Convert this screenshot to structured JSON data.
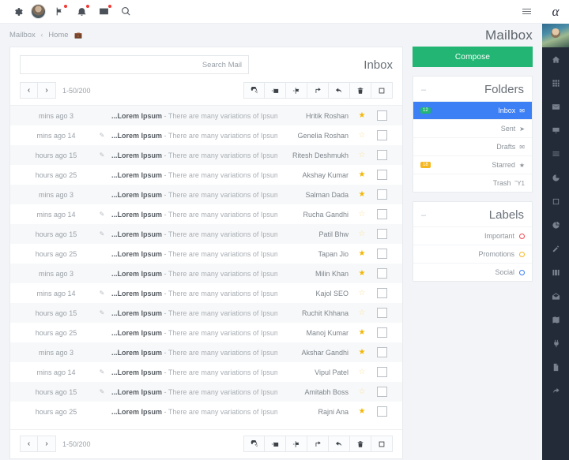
{
  "topbar": {
    "icons": [
      {
        "name": "gear-icon",
        "label": "Settings",
        "dot": false
      },
      {
        "name": "avatar",
        "label": "Profile",
        "dot": false
      },
      {
        "name": "flag-icon",
        "label": "Flags",
        "dot": true
      },
      {
        "name": "bell-icon",
        "label": "Notifications",
        "dot": true
      },
      {
        "name": "envelope-icon",
        "label": "Messages",
        "dot": true
      },
      {
        "name": "search-icon",
        "label": "Search",
        "dot": false
      }
    ],
    "menu_label": "Menu"
  },
  "breadcrumb": {
    "root": "Mailbox",
    "separator": "‹",
    "current": "Home",
    "icon": "briefcase-icon"
  },
  "page": {
    "title": "Mailbox"
  },
  "mailcard": {
    "search_placeholder": "Search Mail",
    "search_value": "",
    "inbox_label": "Inbox",
    "pagination": {
      "prev": "‹",
      "next": "›",
      "count": "1-50/200"
    },
    "tools": [
      {
        "name": "refresh-icon",
        "label": "Refresh"
      },
      {
        "name": "move-to-folder-icon",
        "label": "Move to folder"
      },
      {
        "name": "flag-icon",
        "label": "Flag"
      },
      {
        "name": "forward-icon",
        "label": "Forward"
      },
      {
        "name": "reply-icon",
        "label": "Reply"
      },
      {
        "name": "trash-icon",
        "label": "Delete"
      },
      {
        "name": "select-all-icon",
        "label": "Select all"
      }
    ],
    "subject_prefix": "...Lorem Ipsum",
    "subject_dash": " - ",
    "subject_text": "There are many variations of Ipsum available",
    "clip_glyph": "✎",
    "star_on": "★",
    "star_off": "☆",
    "rows": [
      {
        "time": "mins ago 3",
        "clip": false,
        "name": "Hritik Roshan",
        "starred": true,
        "alt": true
      },
      {
        "time": "mins ago 14",
        "clip": true,
        "name": "Genelia Roshan",
        "starred": false,
        "alt": false
      },
      {
        "time": "hours ago 15",
        "clip": true,
        "name": "Ritesh Deshmukh",
        "starred": false,
        "alt": true
      },
      {
        "time": "hours ago 25",
        "clip": false,
        "name": "Akshay Kumar",
        "starred": true,
        "alt": false
      },
      {
        "time": "mins ago 3",
        "clip": false,
        "name": "Salman Dada",
        "starred": true,
        "alt": true
      },
      {
        "time": "mins ago 14",
        "clip": true,
        "name": "Rucha Gandhi",
        "starred": false,
        "alt": false
      },
      {
        "time": "hours ago 15",
        "clip": true,
        "name": "Patil Bhw",
        "starred": false,
        "alt": true
      },
      {
        "time": "hours ago 25",
        "clip": false,
        "name": "Tapan Jio",
        "starred": true,
        "alt": false
      },
      {
        "time": "mins ago 3",
        "clip": false,
        "name": "Milin Khan",
        "starred": true,
        "alt": true
      },
      {
        "time": "mins ago 14",
        "clip": true,
        "name": "Kajol SEO",
        "starred": false,
        "alt": false
      },
      {
        "time": "hours ago 15",
        "clip": true,
        "name": "Ruchit Khhana",
        "starred": false,
        "alt": true
      },
      {
        "time": "hours ago 25",
        "clip": false,
        "name": "Manoj Kumar",
        "starred": true,
        "alt": false
      },
      {
        "time": "mins ago 3",
        "clip": false,
        "name": "Akshar Gandhi",
        "starred": true,
        "alt": true
      },
      {
        "time": "mins ago 14",
        "clip": true,
        "name": "Vipul Patel",
        "starred": false,
        "alt": false
      },
      {
        "time": "hours ago 15",
        "clip": true,
        "name": "Amitabh Boss",
        "starred": false,
        "alt": true
      },
      {
        "time": "hours ago 25",
        "clip": false,
        "name": "Rajni Ana",
        "starred": true,
        "alt": false
      }
    ]
  },
  "sidebar": {
    "compose_label": "Compose",
    "folders": {
      "title": "Folders",
      "collapse": "–",
      "items": [
        {
          "label": "Inbox",
          "icon": "inbox-icon",
          "glyph": "✉",
          "active": true,
          "badge": "12",
          "badge_color": "#22b573"
        },
        {
          "label": "Sent",
          "icon": "send-icon",
          "glyph": "➤",
          "active": false,
          "badge": "",
          "badge_color": ""
        },
        {
          "label": "Drafts",
          "icon": "drafts-icon",
          "glyph": "✉",
          "active": false,
          "badge": "",
          "badge_color": ""
        },
        {
          "label": "Starred",
          "icon": "star-icon",
          "glyph": "★",
          "active": false,
          "badge": "18",
          "badge_color": "#f5b721"
        },
        {
          "label": "Trash",
          "icon": "trash-icon",
          "glyph": "Ὕ1",
          "active": false,
          "badge": "",
          "badge_color": ""
        }
      ]
    },
    "labels": {
      "title": "Labels",
      "collapse": "–",
      "items": [
        {
          "label": "Important",
          "color": "#ef4b52"
        },
        {
          "label": "Promotions",
          "color": "#f5b721"
        },
        {
          "label": "Social",
          "color": "#3d7ff4"
        }
      ]
    }
  },
  "rail": {
    "logo": "α",
    "icons": [
      {
        "name": "home-icon"
      },
      {
        "name": "grid-icon"
      },
      {
        "name": "mail-icon"
      },
      {
        "name": "monitor-icon"
      },
      {
        "name": "list-icon"
      },
      {
        "name": "pie-chart-icon"
      },
      {
        "name": "square-icon"
      },
      {
        "name": "chart-icon"
      },
      {
        "name": "edit-icon"
      },
      {
        "name": "columns-icon"
      },
      {
        "name": "envelope-open-icon"
      },
      {
        "name": "map-icon"
      },
      {
        "name": "plug-icon"
      },
      {
        "name": "file-icon"
      },
      {
        "name": "share-icon"
      }
    ]
  }
}
